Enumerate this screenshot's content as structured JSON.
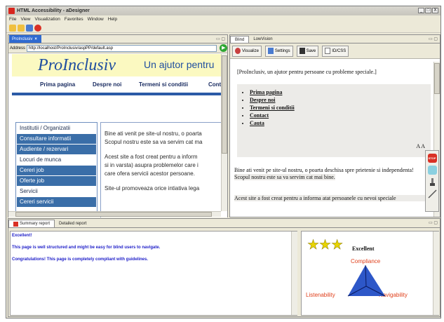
{
  "window": {
    "title": "HTML Accessibility - aDesigner",
    "controls": [
      "_",
      "□",
      "X"
    ]
  },
  "menu": [
    "File",
    "View",
    "Visualization",
    "Favorites",
    "Window",
    "Help"
  ],
  "editor": {
    "tab_label": "ProInclusiv",
    "address_label": "Address",
    "address_value": "http://localhost/ProInclusiv/aspPP/default.asp",
    "site": {
      "brand": "ProInclusiv",
      "slogan": "Un ajutor pentru",
      "nav": [
        "Prima pagina",
        "Despre noi",
        "Termeni si conditii",
        "Cont"
      ],
      "side_menu": [
        {
          "label": "Institutii / Organizatii",
          "style": "w"
        },
        {
          "label": "Consultare informatii",
          "style": "b"
        },
        {
          "label": "Audiente / rezervari",
          "style": "b"
        },
        {
          "label": "Locuri de munca",
          "style": "w"
        },
        {
          "label": "Cereri job",
          "style": "b"
        },
        {
          "label": "Oferte job",
          "style": "b"
        },
        {
          "label": "Servicii",
          "style": "w"
        },
        {
          "label": "Cereri servicii",
          "style": "b"
        }
      ],
      "content": [
        "Bine ati venit pe site-ul nostru, o poarta",
        "Scopul nostru este sa va servim cat ma",
        "Acest site a fost creat pentru a inform",
        "si in varsta) asupra problemelor care i",
        "care ofera servicii acestor persoane.",
        "Site-ul promoveaza orice intiativa lega"
      ]
    }
  },
  "blind_view": {
    "tabs": [
      "Blind",
      "LowVision"
    ],
    "tools": [
      "Visualize",
      "Settings",
      "Save",
      "ID/CSS"
    ],
    "heading": "[ProInclusiv, un ajutor pentru persoane cu probleme speciale.]",
    "links": [
      "Prima pagina",
      "Despre noi",
      "Termeni si conditii",
      "Contact",
      "Cauta"
    ],
    "aa_mark": "A A",
    "para1": "Bine ati venit pe site-ul nostru, o poarta deschisa spre prietenie si independenta!",
    "para1_highlight": "Scopul nostru este sa va servim cat mai bine.",
    "para2": "Acest site a fost creat pentru a informa atat persoanele cu nevoi speciale",
    "stop_label": "STOP"
  },
  "report": {
    "tabs": [
      "Summary report",
      "Detailed report"
    ],
    "lines": [
      "Excellent!",
      "This page is well structured and might be easy for blind users to navigate.",
      "Congratulations! This page is completely compliant with guidelines."
    ],
    "rating": {
      "stars": 3,
      "grade": "Excellent",
      "labels": {
        "top": "Compliance",
        "left": "Listenability",
        "right": "Navigability"
      },
      "colors": {
        "triangle": "#2d57c8",
        "labels": "#e0401c",
        "star": "#e8d400"
      }
    }
  }
}
